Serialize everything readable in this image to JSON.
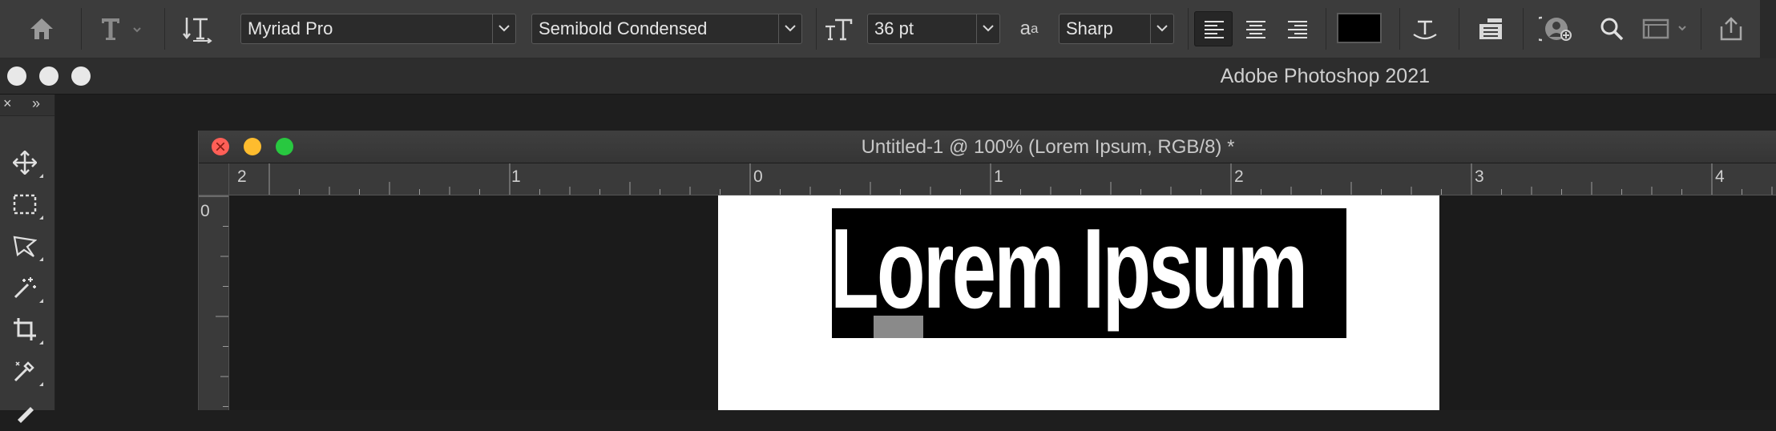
{
  "options_bar": {
    "font_family": "Myriad Pro",
    "font_style": "Semibold Condensed",
    "font_size": "36 pt",
    "antialias_icon_label": "a",
    "antialias_icon_label_small": "a",
    "antialias": "Sharp",
    "text_color": "#000000",
    "icons": [
      "home-icon",
      "text-tool-icon",
      "toggle-orientation-icon",
      "font-size-icon",
      "antialias-icon",
      "align-left-icon",
      "align-center-icon",
      "align-right-icon",
      "warp-text-icon",
      "character-panel-icon",
      "cloud-account-icon",
      "search-icon",
      "workspace-icon",
      "share-icon"
    ]
  },
  "app_bar": {
    "title": "Adobe Photoshop 2021"
  },
  "tools_panel": {
    "close_label": "×",
    "expand_label": "»",
    "tools": [
      "move-tool-icon",
      "marquee-tool-icon",
      "lasso-tool-icon",
      "magic-wand-tool-icon",
      "crop-tool-icon",
      "eyedropper-tool-icon",
      "brush-tool-icon"
    ]
  },
  "document": {
    "title": "Untitled-1 @ 100% (Lorem Ipsum, RGB/8) *",
    "ruler_top_labels": [
      "2",
      "1",
      "0",
      "1",
      "2",
      "3",
      "4"
    ],
    "ruler_left_labels": [
      "0"
    ],
    "text_content": "Lorem Ipsum"
  },
  "colors": {
    "accent_close": "#ff5f57",
    "accent_minimize": "#febc2e",
    "accent_zoom": "#28c840",
    "selection": "#000000"
  }
}
